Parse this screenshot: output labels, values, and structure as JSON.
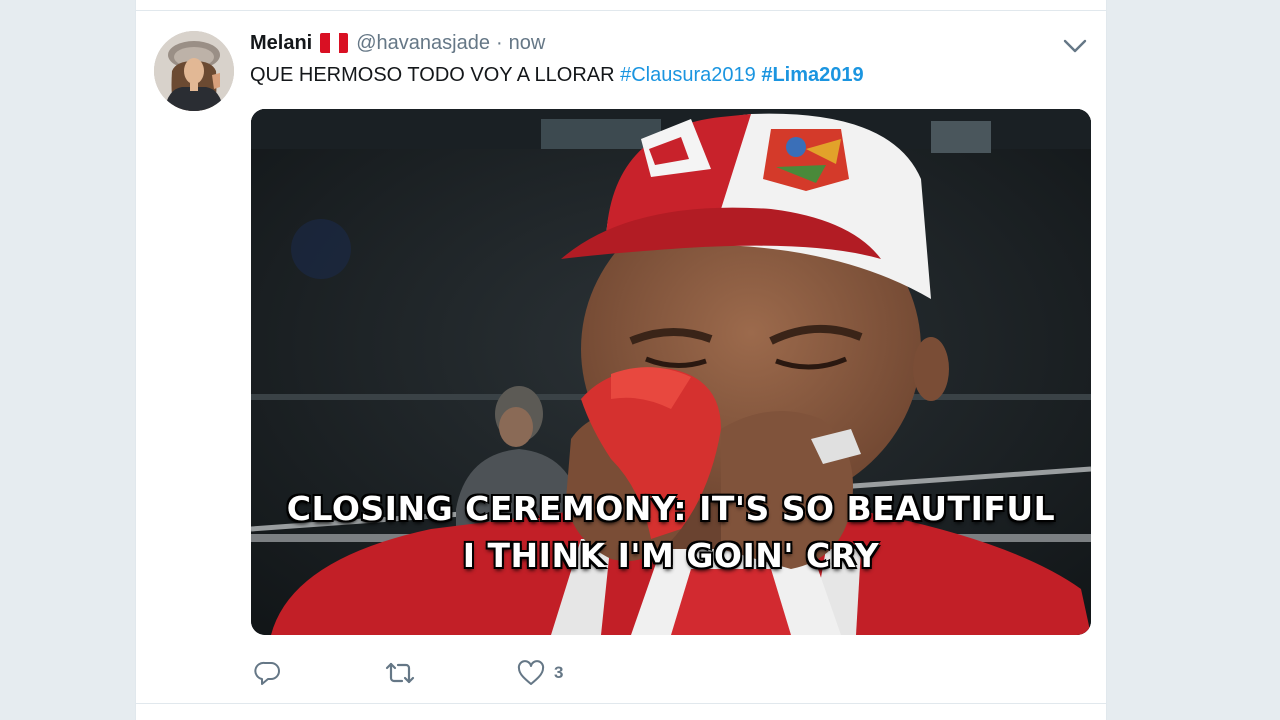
{
  "tweet": {
    "author_name": "Melani",
    "author_flag": "peru-flag",
    "handle": "@havanasjade",
    "separator": "·",
    "timestamp": "now",
    "text_plain": "QUE HERMOSO TODO VOY A LLORAR ",
    "hashtags": [
      {
        "text": "#Clausura2019",
        "bold": false
      },
      {
        "text": "#Lima2019",
        "bold": true
      }
    ],
    "media": {
      "caption_line1": "CLOSING CEREMONY: IT'S SO BEAUTIFUL",
      "caption_line2": "I THINK I'M GOIN' CRY"
    },
    "actions": {
      "reply_icon": "reply-icon",
      "retweet_icon": "retweet-icon",
      "like_icon": "heart-icon",
      "like_count": "3"
    }
  },
  "colors": {
    "page_background": "#e6ecf0",
    "card_background": "#ffffff",
    "text_primary": "#14171a",
    "text_secondary": "#657786",
    "link_blue": "#1b95e0"
  }
}
